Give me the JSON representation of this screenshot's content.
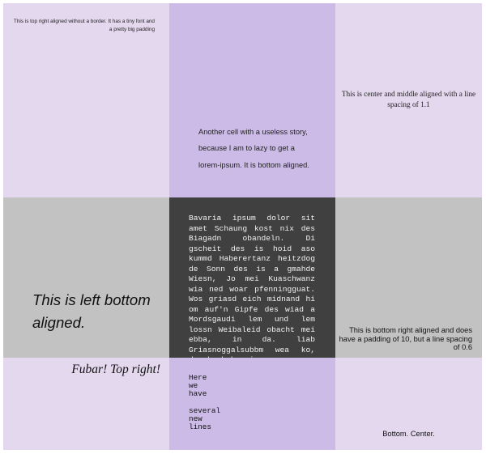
{
  "cells": {
    "r1c1": "This is top right aligned without a border. It has a tiny font and a pretty big padding",
    "r1c2": "Another cell with a useless story, because I am to lazy to get a lorem-ipsum. It is bottom aligned.",
    "r1c3": "This is center and middle aligned with a line spacing of 1.1",
    "r2c1": "This is left bottom aligned.",
    "r2c2": "Bavaria ipsum dolor sit amet Schaung kost nix des Biagadn obandeln. Di gscheit des is hoid aso kummd Haberertanz heitzdog de Sonn des is a gmahde Wiesn, Jo mei Kuaschwanz wia ned woar pfenningguat. Wos griasd eich midnand hi om auf'n Gipfe des wiad a Mordsgaudi lem und lem lossn Weibaleid obacht mei ebba, in da. liab Griasnoggalsubbm wea ko, dea ko hob mei.",
    "r2c3": "This is bottom right aligned and does have a padding of 10, but a line spacing of 0.6",
    "r3c1": "Fubar! Top right!",
    "r3c2": "Here\nwe\nhave\n\nseveral\nnew\nlines",
    "r3c3": "Bottom. Center."
  },
  "colors": {
    "lavender": "#e4d8ef",
    "purple": "#cbbbe6",
    "gray": "#c2c2c2",
    "dark": "#404040"
  }
}
